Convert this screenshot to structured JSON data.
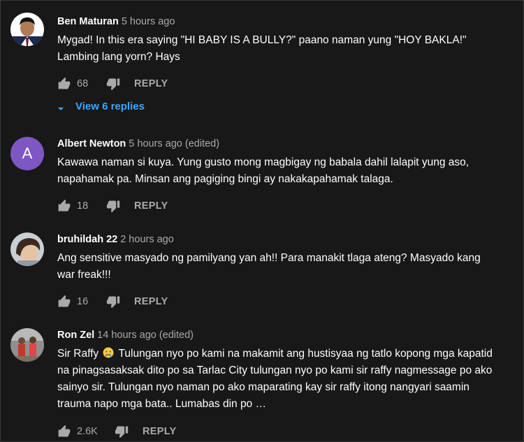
{
  "comments": [
    {
      "author": "Ben Maturan",
      "time": "5 hours ago",
      "text": "Mygad! In this era saying \"HI BABY IS A BULLY?\" paano naman yung \"HOY BAKLA!\" Lambing lang yorn? Hays",
      "likes": "68",
      "reply_label": "REPLY",
      "view_replies": "View 6 replies"
    },
    {
      "author": "Albert Newton",
      "time": "5 hours ago (edited)",
      "avatar_letter": "A",
      "text": "Kawawa naman si kuya. Yung gusto mong magbigay ng babala dahil lalapit yung aso, napahamak pa. Minsan ang pagiging bingi ay nakakapahamak talaga.",
      "likes": "18",
      "reply_label": "REPLY"
    },
    {
      "author": "bruhildah 22",
      "time": "2 hours ago",
      "text": "Ang sensitive masyado ng  pamilyang yan ah!! Para manakit tlaga ateng? Masyado kang war freak!!!",
      "likes": "16",
      "reply_label": "REPLY"
    },
    {
      "author": "Ron Zel",
      "time": "14 hours ago (edited)",
      "text_before_emoji": "Sir Raffy",
      "text_after_emoji": " Tulungan nyo po kami na makamit ang hustisyaa ng tatlo kopong mga kapatid na pinagsasaksak dito po sa Tarlac City tulungan nyo po kami sir raffy nagmessage po ako sainyo sir.  Tulungan nyo naman po ako maparating kay sir raffy itong nangyari saamin trauma napo mga bata.. Lumabas din po …",
      "likes": "2.6K",
      "reply_label": "REPLY"
    }
  ],
  "colors": {
    "background": "#181818",
    "text": "#ffffff",
    "secondary": "#aaaaaa",
    "link": "#3ea6ff",
    "letter_avatar": "#7e57c2"
  },
  "icons": [
    "thumbs-up-icon",
    "thumbs-down-icon",
    "chevron-down-icon",
    "crying-face-emoji"
  ]
}
